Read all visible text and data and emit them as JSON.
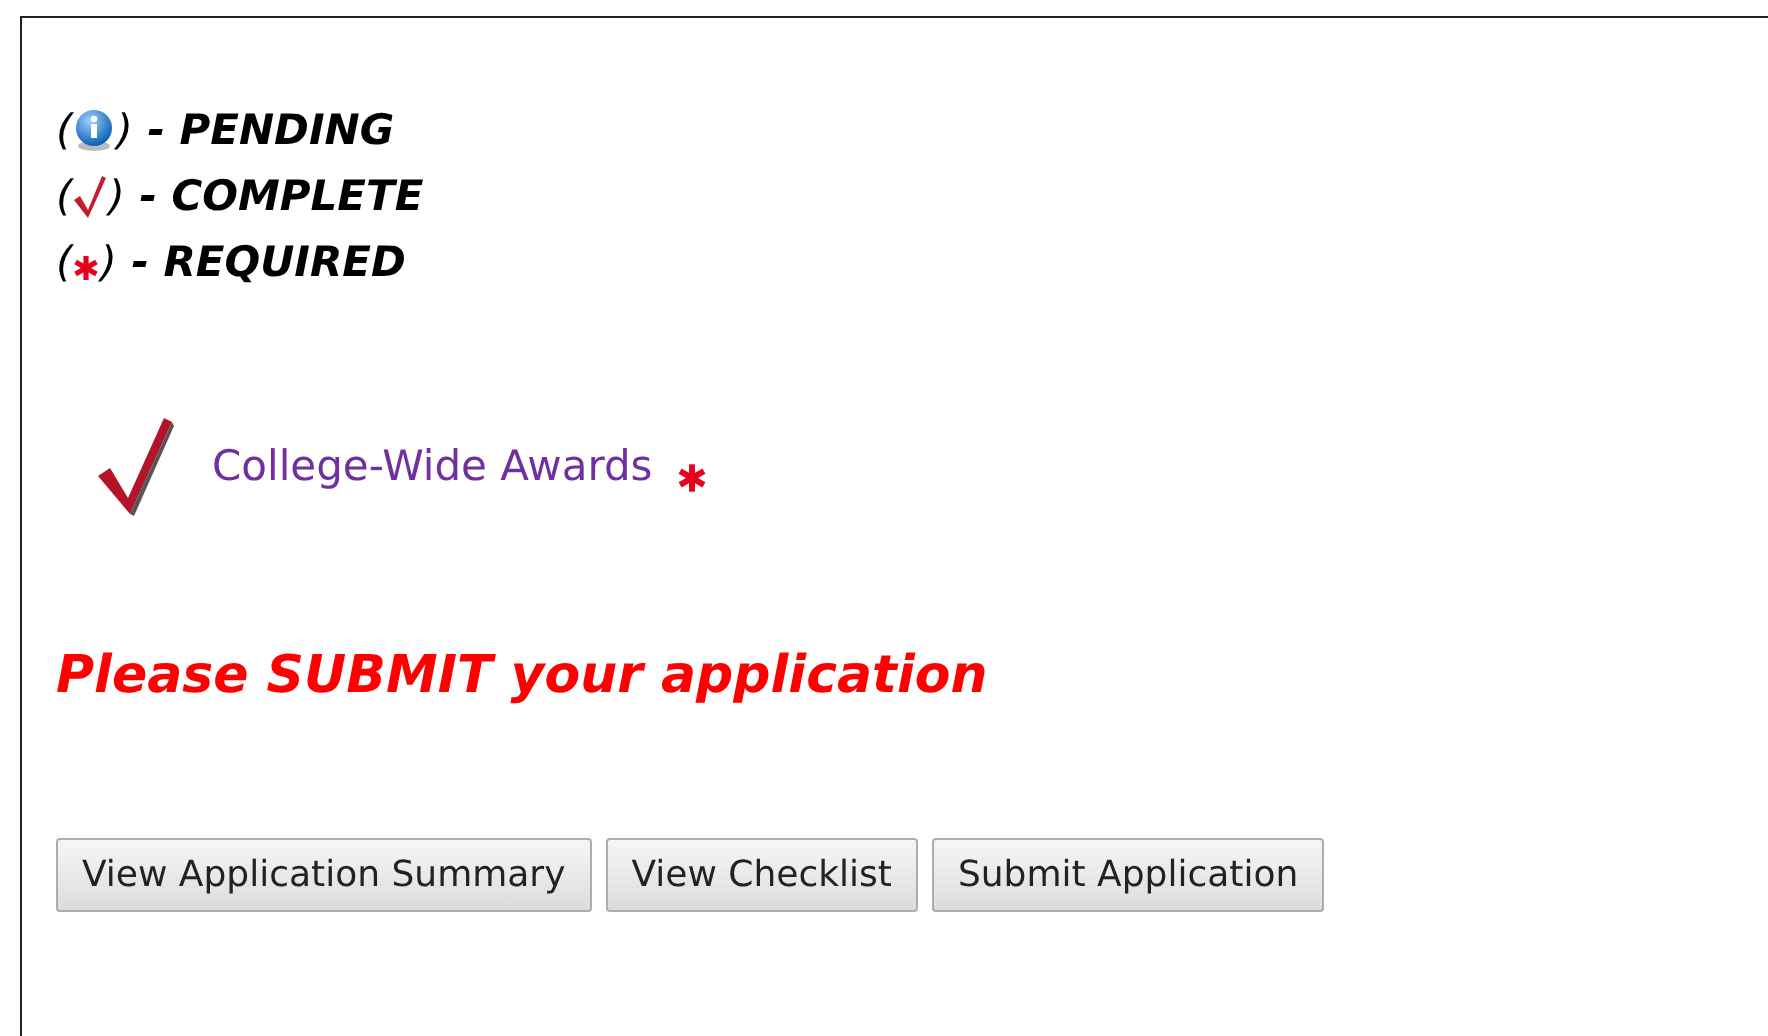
{
  "legend": [
    {
      "kind": "pending",
      "open": "(",
      "close": ")",
      "label": " - PENDING"
    },
    {
      "kind": "complete",
      "open": "(",
      "close": ")",
      "label": " - COMPLETE"
    },
    {
      "kind": "required",
      "open": "(",
      "close": ")",
      "label": " - REQUIRED"
    }
  ],
  "awards": [
    {
      "complete": true,
      "label": "College-Wide Awards",
      "required": true
    }
  ],
  "message": "Please SUBMIT your application",
  "buttons": [
    "View Application Summary",
    "View Checklist",
    "Submit Application"
  ]
}
